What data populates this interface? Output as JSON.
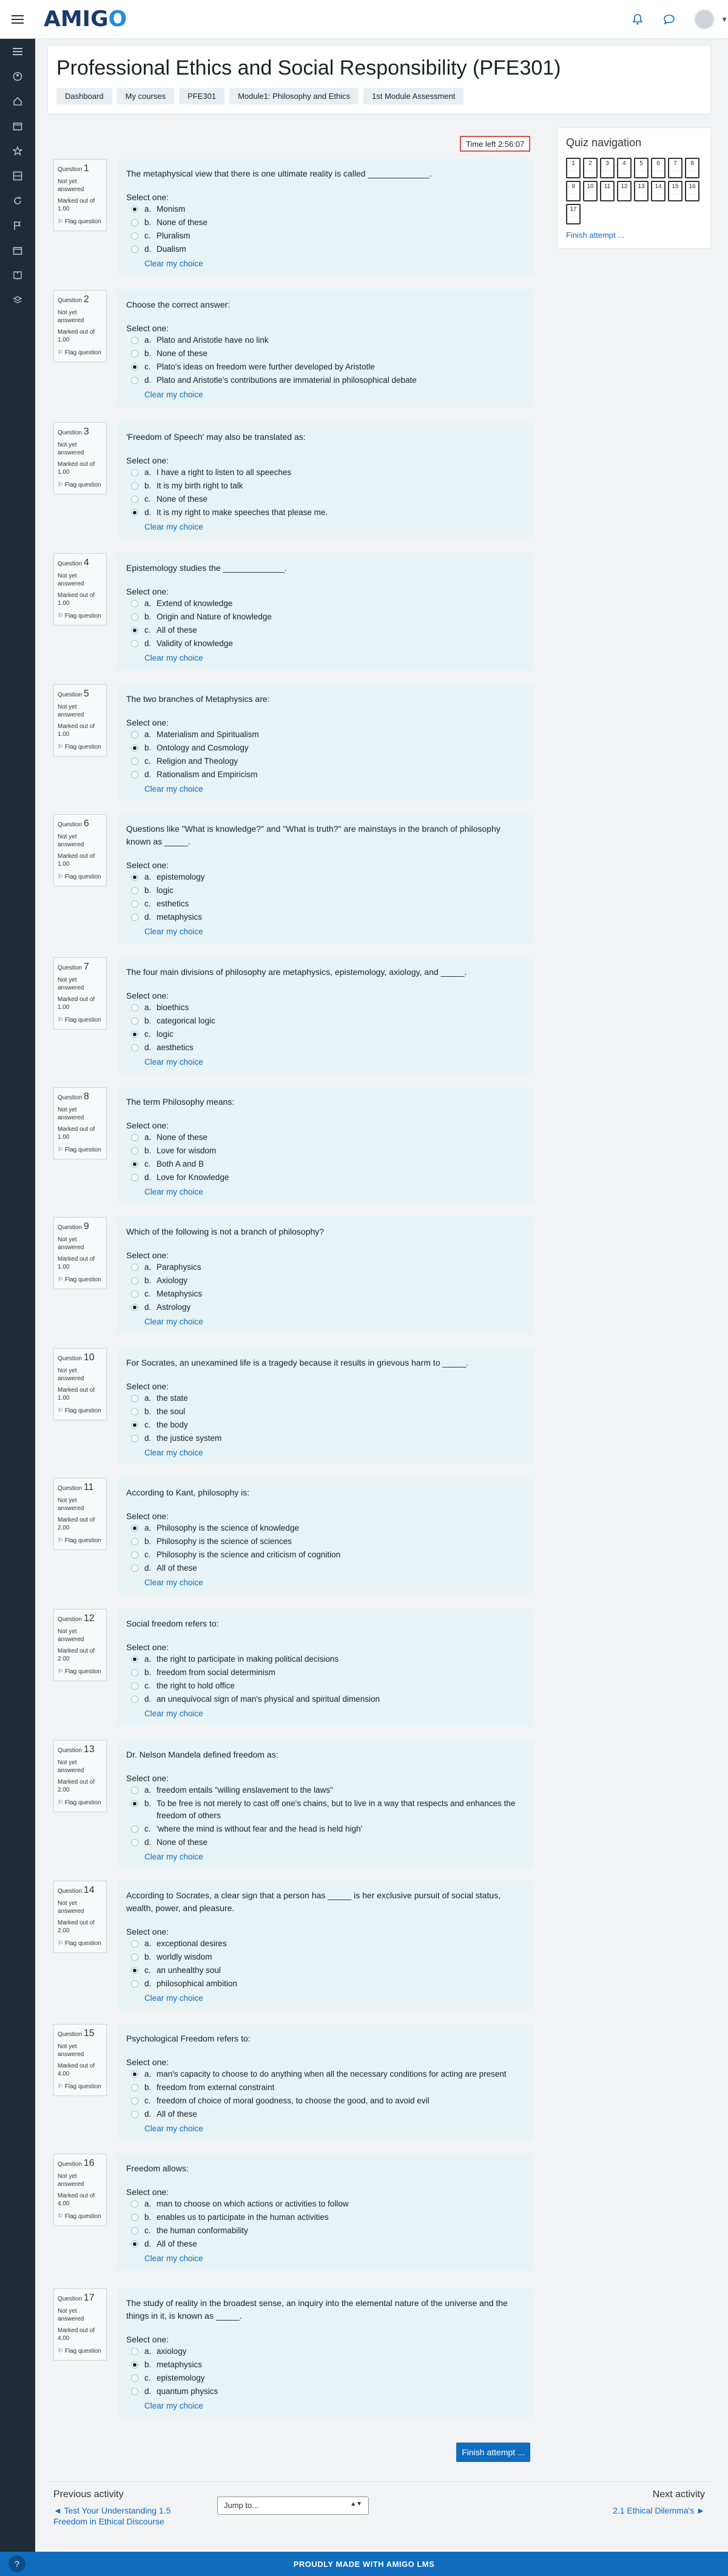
{
  "header": {
    "logo_main": "AMIG",
    "logo_accent": "O",
    "menu_icon": "hamburger-icon",
    "icons": [
      "bell-icon",
      "chat-icon",
      "avatar"
    ]
  },
  "sidebar": {
    "items": [
      "list-icon",
      "dashboard-icon",
      "home-icon",
      "calendar-icon",
      "star-icon",
      "grid-icon",
      "refresh-icon",
      "flag-icon",
      "calendar-icon",
      "book-icon",
      "layers-icon"
    ]
  },
  "page": {
    "title": "Professional Ethics and Social Responsibility (PFE301)",
    "breadcrumbs": [
      "Dashboard",
      "My courses",
      "PFE301",
      "Module1: Philosophy and Ethics",
      "1st Module Assessment"
    ]
  },
  "timer": {
    "label": "Time left 2:56:07"
  },
  "quiz_nav": {
    "title": "Quiz navigation",
    "numbers": [
      "1",
      "2",
      "3",
      "4",
      "5",
      "6",
      "7",
      "8",
      "9",
      "10",
      "11",
      "12",
      "13",
      "14",
      "15",
      "16",
      "17"
    ],
    "finish_link": "Finish attempt ..."
  },
  "common": {
    "question_label": "Question",
    "status": "Not yet answered",
    "flag": "Flag question",
    "select_one": "Select one:",
    "clear": "Clear my choice"
  },
  "questions": [
    {
      "num": "1",
      "marked": "Marked out of 1.00",
      "text": "The metaphysical view that there is one ultimate reality is called _____________.",
      "options": [
        {
          "l": "a.",
          "t": "Monism"
        },
        {
          "l": "b.",
          "t": "None of these"
        },
        {
          "l": "c.",
          "t": "Pluralism"
        },
        {
          "l": "d.",
          "t": "Dualism"
        }
      ],
      "selected": 0
    },
    {
      "num": "2",
      "marked": "Marked out of 1.00",
      "text": "Choose the correct answer:",
      "options": [
        {
          "l": "a.",
          "t": "Plato and Aristotle have no link"
        },
        {
          "l": "b.",
          "t": "None of these"
        },
        {
          "l": "c.",
          "t": "Plato's ideas on freedom were further developed by Aristotle"
        },
        {
          "l": "d.",
          "t": "Plato and Aristotle's contributions are immaterial in philosophical debate"
        }
      ],
      "selected": 2
    },
    {
      "num": "3",
      "marked": "Marked out of 1.00",
      "text": "'Freedom of Speech' may also be translated as:",
      "options": [
        {
          "l": "a.",
          "t": "I have a right to listen to all speeches"
        },
        {
          "l": "b.",
          "t": "It is my birth right to talk"
        },
        {
          "l": "c.",
          "t": "None of these"
        },
        {
          "l": "d.",
          "t": "It is my right to make speeches that please me."
        }
      ],
      "selected": 3
    },
    {
      "num": "4",
      "marked": "Marked out of 1.00",
      "text": "Epistemology studies the _____________.",
      "options": [
        {
          "l": "a.",
          "t": "Extend of knowledge"
        },
        {
          "l": "b.",
          "t": "Origin and Nature of knowledge"
        },
        {
          "l": "c.",
          "t": "All of these"
        },
        {
          "l": "d.",
          "t": "Validity of knowledge"
        }
      ],
      "selected": 2
    },
    {
      "num": "5",
      "marked": "Marked out of 1.00",
      "text": "The two branches of Metaphysics are:",
      "options": [
        {
          "l": "a.",
          "t": "Materialism and Spiritualism"
        },
        {
          "l": "b.",
          "t": "Ontology and Cosmology"
        },
        {
          "l": "c.",
          "t": "Religion and Theology"
        },
        {
          "l": "d.",
          "t": "Rationalism and Empiricism"
        }
      ],
      "selected": 1
    },
    {
      "num": "6",
      "marked": "Marked out of 1.00",
      "text": "Questions like \"What is knowledge?\" and \"What is truth?\" are mainstays in the branch of philosophy known as _____.",
      "options": [
        {
          "l": "a.",
          "t": "epistemology"
        },
        {
          "l": "b.",
          "t": "logic"
        },
        {
          "l": "c.",
          "t": "esthetics"
        },
        {
          "l": "d.",
          "t": "metaphysics"
        }
      ],
      "selected": 0
    },
    {
      "num": "7",
      "marked": "Marked out of 1.00",
      "text": "The four main divisions of philosophy are metaphysics, epistemology, axiology, and _____.",
      "options": [
        {
          "l": "a.",
          "t": "bioethics"
        },
        {
          "l": "b.",
          "t": "categorical logic"
        },
        {
          "l": "c.",
          "t": "logic"
        },
        {
          "l": "d.",
          "t": "aesthetics"
        }
      ],
      "selected": 2
    },
    {
      "num": "8",
      "marked": "Marked out of 1.00",
      "text": "The term Philosophy means:",
      "options": [
        {
          "l": "a.",
          "t": "None of these"
        },
        {
          "l": "b.",
          "t": "Love for wisdom"
        },
        {
          "l": "c.",
          "t": "Both A and B"
        },
        {
          "l": "d.",
          "t": "Love for Knowledge"
        }
      ],
      "selected": 2
    },
    {
      "num": "9",
      "marked": "Marked out of 1.00",
      "text": "Which of the following is not a branch of philosophy?",
      "options": [
        {
          "l": "a.",
          "t": "Paraphysics"
        },
        {
          "l": "b.",
          "t": "Axiology"
        },
        {
          "l": "c.",
          "t": "Metaphysics"
        },
        {
          "l": "d.",
          "t": "Astrology"
        }
      ],
      "selected": 3
    },
    {
      "num": "10",
      "marked": "Marked out of 1.00",
      "text": "For Socrates, an unexamined life is a tragedy because it results in grievous harm to _____.",
      "options": [
        {
          "l": "a.",
          "t": "the state"
        },
        {
          "l": "b.",
          "t": "the soul"
        },
        {
          "l": "c.",
          "t": "the body"
        },
        {
          "l": "d.",
          "t": "the justice system"
        }
      ],
      "selected": 2
    },
    {
      "num": "11",
      "marked": "Marked out of 2.00",
      "text": "According to Kant, philosophy is:",
      "options": [
        {
          "l": "a.",
          "t": "Philosophy is the science of knowledge"
        },
        {
          "l": "b.",
          "t": "Philosophy is the science of sciences"
        },
        {
          "l": "c.",
          "t": "Philosophy is the science and criticism of cognition"
        },
        {
          "l": "d.",
          "t": "All of these"
        }
      ],
      "selected": 0
    },
    {
      "num": "12",
      "marked": "Marked out of 2.00",
      "text": "Social freedom refers to:",
      "options": [
        {
          "l": "a.",
          "t": "the right to participate in making political decisions"
        },
        {
          "l": "b.",
          "t": "freedom from social determinism"
        },
        {
          "l": "c.",
          "t": "the right to hold office"
        },
        {
          "l": "d.",
          "t": "an unequivocal sign of man's physical and spiritual dimension"
        }
      ],
      "selected": 0
    },
    {
      "num": "13",
      "marked": "Marked out of 2.00",
      "text": "Dr. Nelson Mandela defined freedom as:",
      "options": [
        {
          "l": "a.",
          "t": "freedom entails \"willing enslavement to the laws\""
        },
        {
          "l": "b.",
          "t": "To be free is not merely to cast off one's chains, but to live in a way that respects and enhances the freedom of others"
        },
        {
          "l": "c.",
          "t": "'where the mind is without fear and the head is held high'"
        },
        {
          "l": "d.",
          "t": "None of these"
        }
      ],
      "selected": 1
    },
    {
      "num": "14",
      "marked": "Marked out of 2.00",
      "text": "According to Socrates, a clear sign that a person has _____ is her exclusive pursuit of social status, wealth, power, and pleasure.",
      "options": [
        {
          "l": "a.",
          "t": "exceptional desires"
        },
        {
          "l": "b.",
          "t": "worldly wisdom"
        },
        {
          "l": "c.",
          "t": "an unhealthy soul"
        },
        {
          "l": "d.",
          "t": "philosophical ambition"
        }
      ],
      "selected": 2
    },
    {
      "num": "15",
      "marked": "Marked out of 4.00",
      "text": "Psychological Freedom refers to:",
      "options": [
        {
          "l": "a.",
          "t": "man's capacity to choose to do anything when all the necessary conditions for acting are present"
        },
        {
          "l": "b.",
          "t": "freedom from external constraint"
        },
        {
          "l": "c.",
          "t": "freedom of choice of moral goodness, to choose the good, and to avoid evil"
        },
        {
          "l": "d.",
          "t": "All of these"
        }
      ],
      "selected": 0
    },
    {
      "num": "16",
      "marked": "Marked out of 4.00",
      "text": "Freedom allows:",
      "options": [
        {
          "l": "a.",
          "t": "man to choose on which actions or activities to follow"
        },
        {
          "l": "b.",
          "t": "enables us to participate in the human activities"
        },
        {
          "l": "c.",
          "t": "the human conformability"
        },
        {
          "l": "d.",
          "t": "All of these"
        }
      ],
      "selected": 3
    },
    {
      "num": "17",
      "marked": "Marked out of 4.00",
      "text": "The study of reality in the broadest sense, an inquiry into the elemental nature of the universe and the things in it, is known as _____.",
      "options": [
        {
          "l": "a.",
          "t": "axiology"
        },
        {
          "l": "b.",
          "t": "metaphysics"
        },
        {
          "l": "c.",
          "t": "epistemology"
        },
        {
          "l": "d.",
          "t": "quantum physics"
        }
      ],
      "selected": 1
    }
  ],
  "footer_nav": {
    "finish_button": "Finish attempt ...",
    "prev_heading": "Previous activity",
    "prev_link": "◄ Test Your Understanding 1.5 Freedom in Ethical Discourse",
    "jump_placeholder": "Jump to...",
    "next_heading": "Next activity",
    "next_link": "2.1 Ethical Dilemma's ►"
  },
  "footer": {
    "text": "PROUDLY MADE WITH AMIGO LMS"
  }
}
